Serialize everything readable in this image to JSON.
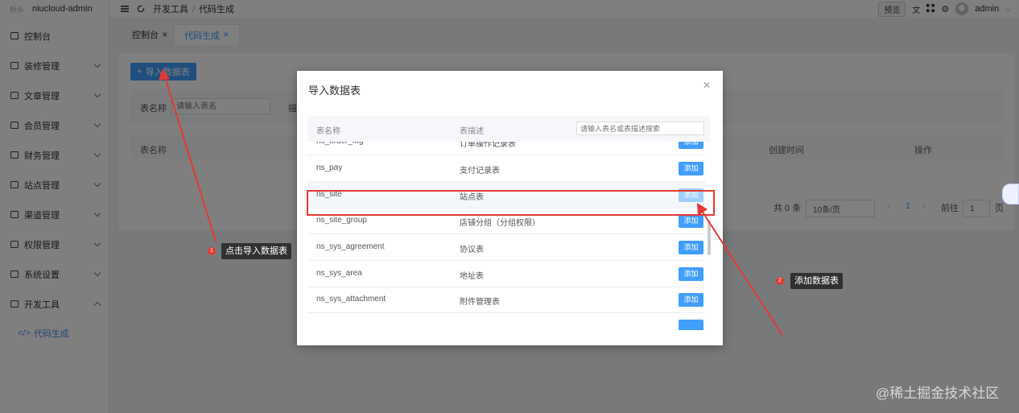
{
  "app": {
    "logo_text": "标头",
    "name": "niucloud-admin"
  },
  "sidebar": {
    "items": [
      {
        "label": "控制台",
        "icon": "monitor-icon",
        "expandable": false
      },
      {
        "label": "装修管理",
        "icon": "box-icon",
        "expandable": true
      },
      {
        "label": "文章管理",
        "icon": "document-icon",
        "expandable": true
      },
      {
        "label": "会员管理",
        "icon": "user-icon",
        "expandable": true
      },
      {
        "label": "财务管理",
        "icon": "wallet-icon",
        "expandable": true
      },
      {
        "label": "站点管理",
        "icon": "site-icon",
        "expandable": true
      },
      {
        "label": "渠道管理",
        "icon": "channel-icon",
        "expandable": true
      },
      {
        "label": "权限管理",
        "icon": "lock-icon",
        "expandable": true
      },
      {
        "label": "系统设置",
        "icon": "gear-icon",
        "expandable": true
      },
      {
        "label": "开发工具",
        "icon": "edit-icon",
        "expandable": true,
        "expanded": true
      }
    ],
    "sub_item": {
      "label": "代码生成",
      "icon": "code-icon"
    }
  },
  "header": {
    "breadcrumb": [
      "开发工具",
      "代码生成"
    ],
    "preview_label": "预览",
    "user": "admin"
  },
  "tabs": [
    {
      "label": "控制台",
      "active": false
    },
    {
      "label": "代码生成",
      "active": true
    }
  ],
  "page": {
    "import_button": "导入数据表",
    "filter_label": "表名称",
    "filter_placeholder": "请输入表名",
    "filter_label2": "描",
    "columns": [
      "表名称",
      "创建时间",
      "操作"
    ],
    "pagination": {
      "total": "共 0 条",
      "page_size": "10条/页",
      "current": "1",
      "goto": "前往",
      "goto_value": "1",
      "page_unit": "页"
    }
  },
  "dialog": {
    "title": "导入数据表",
    "col_name": "表名称",
    "col_desc": "表描述",
    "search_placeholder": "请输入表名或表描述搜索",
    "add_label": "添加",
    "rows": [
      {
        "name": "ns_order_log",
        "desc": "订单操作记录表"
      },
      {
        "name": "ns_pay",
        "desc": "支付记录表"
      },
      {
        "name": "ns_site",
        "desc": "站点表"
      },
      {
        "name": "ns_site_group",
        "desc": "店铺分组（分组权限）"
      },
      {
        "name": "ns_sys_agreement",
        "desc": "协议表"
      },
      {
        "name": "ns_sys_area",
        "desc": "地址表"
      },
      {
        "name": "ns_sys_attachment",
        "desc": "附件管理表"
      }
    ]
  },
  "annotations": [
    {
      "number": "1",
      "text": "点击导入数据表"
    },
    {
      "number": "2",
      "text": "添加数据表"
    }
  ],
  "watermark": "@稀土掘金技术社区",
  "colors": {
    "primary": "#409eff",
    "annotation": "#e53935"
  }
}
